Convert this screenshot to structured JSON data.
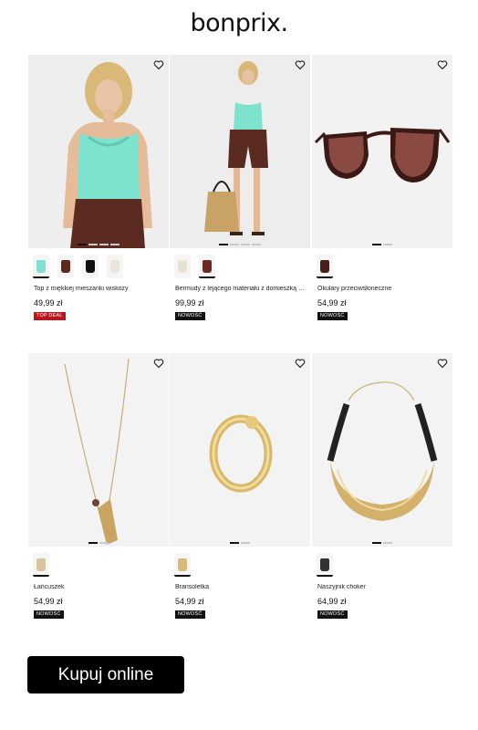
{
  "brand": {
    "logo": "bonprix."
  },
  "products": [
    {
      "name": "Top z miękkiej mieszanki wiskozy",
      "price": "49,99 zł",
      "badge": "TOP DEAL",
      "badge_kind": "deal",
      "swatches": [
        "#7fe0cf",
        "#5e2a1f",
        "#111111",
        "#ece6da"
      ]
    },
    {
      "name": "Bermudy z lejącego materiału z domieszką wiskozy",
      "price": "99,99 zł",
      "badge": "NOWOŚĆ",
      "badge_kind": "new",
      "swatches": [
        "#e9e1d1",
        "#6b2a22"
      ]
    },
    {
      "name": "Okulary przeciwsłoneczne",
      "price": "54,99 zł",
      "badge": "NOWOŚĆ",
      "badge_kind": "new",
      "swatches": [
        "#4a1e1a"
      ]
    },
    {
      "name": "Łańcuszek",
      "price": "54,99 zł",
      "badge": "NOWOŚĆ",
      "badge_kind": "new",
      "swatches": [
        "#d8c49a"
      ]
    },
    {
      "name": "Bransoletka",
      "price": "54,99 zł",
      "badge": "NOWOŚĆ",
      "badge_kind": "new",
      "swatches": [
        "#d6bb7a"
      ]
    },
    {
      "name": "Naszyjnik choker",
      "price": "64,99 zł",
      "badge": "NOWOŚĆ",
      "badge_kind": "new",
      "swatches": [
        "#333333"
      ]
    }
  ],
  "cta": {
    "label": "Kupuj online"
  },
  "colors": {
    "accent_deal": "#c0121b",
    "cta_bg": "#000000"
  },
  "icons": [
    "heart-icon"
  ]
}
